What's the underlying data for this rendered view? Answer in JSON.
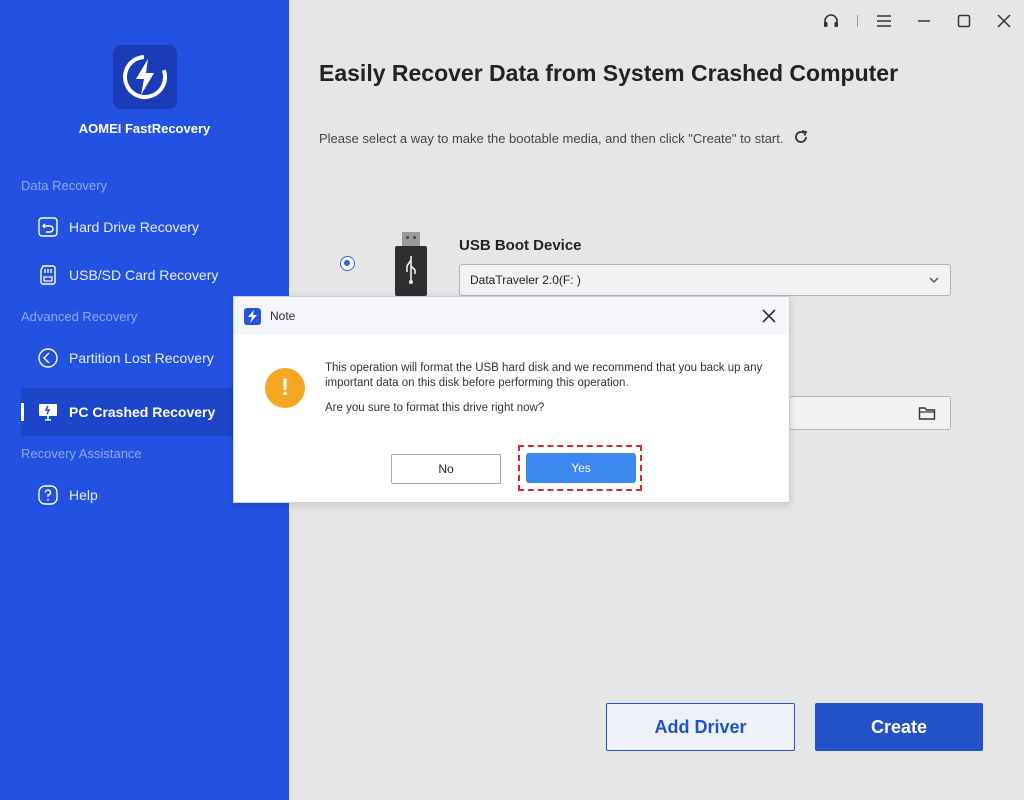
{
  "sidebar": {
    "app_name": "AOMEI FastRecovery",
    "sections": {
      "data_recovery": "Data Recovery",
      "advanced_recovery": "Advanced Recovery",
      "recovery_assistance": "Recovery Assistance"
    },
    "items": [
      {
        "label": "Hard Drive Recovery",
        "icon": "hard-drive-icon"
      },
      {
        "label": "USB/SD Card Recovery",
        "icon": "sd-card-icon"
      },
      {
        "label": "Partition Lost Recovery",
        "icon": "partition-icon"
      },
      {
        "label": "PC Crashed Recovery",
        "icon": "monitor-icon",
        "active": true
      },
      {
        "label": "Help",
        "icon": "help-icon"
      }
    ]
  },
  "main": {
    "title": "Easily Recover Data from System Crashed Computer",
    "subtitle": "Please select a way to make the bootable media, and then click \"Create\" to start.",
    "usb_option": {
      "label": "USB Boot Device",
      "selected_device": "DataTraveler 2.0(F: )"
    },
    "add_driver_label": "Add Driver",
    "create_label": "Create"
  },
  "dialog": {
    "title": "Note",
    "message": "This operation will format the USB hard disk and we recommend that you back up any important data on this disk before performing this operation.",
    "question": "Are you sure to format this drive right now?",
    "warning_icon": "!",
    "no_label": "No",
    "yes_label": "Yes"
  },
  "colors": {
    "sidebar": "#2352e3",
    "primary_button": "#2352c8",
    "dialog_yes": "#3d88ef",
    "warning": "#f5a623",
    "highlight": "#d9232e"
  }
}
